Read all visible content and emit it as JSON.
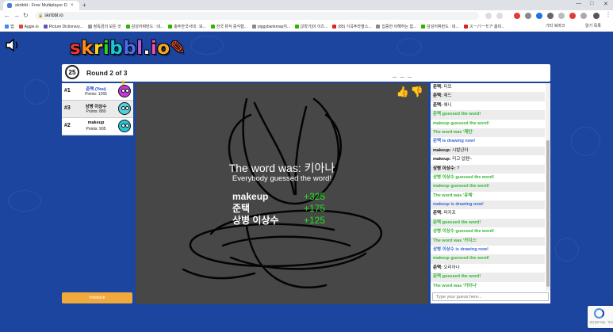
{
  "browser": {
    "tab_title": "skribbl - Free Multiplayer D",
    "tab_close": "×",
    "new_tab": "+",
    "url": "skribbl.io",
    "bookmarks": [
      {
        "label": "앱",
        "color": "#4285f4"
      },
      {
        "label": "Aggie.io",
        "color": "#e0433a"
      },
      {
        "label": "Picture Dictionary...",
        "color": "#6b4fbb"
      },
      {
        "label": "정독곰의 모든 것",
        "color": "#999999"
      },
      {
        "label": "감성어휘만드 : 네...",
        "color": "#2db400"
      },
      {
        "label": "충주한국사대 : 보...",
        "color": "#2db400"
      },
      {
        "label": "전국 뮤식 중식협...",
        "color": "#2db400"
      },
      {
        "label": "piggybankmap지...",
        "color": "#888888"
      },
      {
        "label": "[2학기]이 이즈...",
        "color": "#2db400"
      },
      {
        "label": "(85) 가곡주라열스...",
        "color": "#e02020"
      },
      {
        "label": "집중한 이해하는 힘...",
        "color": "#888888"
      },
      {
        "label": "감성어휘만드 : 네...",
        "color": "#2db400"
      },
      {
        "label": "スーパーモア 홈미...",
        "color": "#e02020"
      }
    ],
    "bookmarks_right": [
      "기타 북마크",
      "읽기 목록"
    ]
  },
  "game": {
    "logo_letters": [
      {
        "ch": "s",
        "color": "#e53935"
      },
      {
        "ch": "k",
        "color": "#ff8c1a"
      },
      {
        "ch": "r",
        "color": "#ffd21f"
      },
      {
        "ch": "i",
        "color": "#2ed12e"
      },
      {
        "ch": "b",
        "color": "#19c6d6"
      },
      {
        "ch": "b",
        "color": "#4a6cf0"
      },
      {
        "ch": "l",
        "color": "#b05be6"
      },
      {
        "ch": ".",
        "color": "#f2f2f2"
      },
      {
        "ch": "i",
        "color": "#ec4fb5"
      },
      {
        "ch": "o",
        "color": "#f5a623"
      },
      {
        "ch": "✎",
        "color": "#ff5722"
      }
    ],
    "timer": "25",
    "round": "Round 2 of 3",
    "hint": "_ _ _",
    "votekick": "Votekick"
  },
  "players": [
    {
      "rank": "#1",
      "name": "준택 (You)",
      "points": "Points: 1265",
      "you": true,
      "avatar_color": "#c23ad6",
      "crown": true
    },
    {
      "rank": "#3",
      "name": "상병 이상수",
      "points": "Points: 880",
      "you": false,
      "avatar_color": "#4fd3e0",
      "crown": false
    },
    {
      "rank": "#2",
      "name": "makeup",
      "points": "Points: 905",
      "you": false,
      "avatar_color": "#22c7d8",
      "crown": false
    }
  ],
  "overlay": {
    "title": "The word was: 키아나",
    "subtitle": "Everybody guessed the word!",
    "scores": [
      {
        "name": "makeup",
        "delta": "+325"
      },
      {
        "name": "준택",
        "delta": "+175"
      },
      {
        "name": "상병 이상수",
        "delta": "+125"
      }
    ]
  },
  "chat": {
    "placeholder": "Type your guess here...",
    "messages": [
      {
        "type": "msg",
        "name": "준택:",
        "text": "티모"
      },
      {
        "type": "msg",
        "name": "준택:",
        "text": "제드"
      },
      {
        "type": "msg",
        "name": "준택:",
        "text": "애니"
      },
      {
        "type": "guess",
        "name": "",
        "text": "준택 guessed the word!"
      },
      {
        "type": "guess",
        "name": "",
        "text": "makeup guessed the word!"
      },
      {
        "type": "word",
        "name": "",
        "text": "The word was '케인'"
      },
      {
        "type": "draw",
        "name": "",
        "text": "준택 is drawing now!"
      },
      {
        "type": "msg",
        "name": "makeup:",
        "text": "시발년아"
      },
      {
        "type": "msg",
        "name": "makeup:",
        "text": "리고 압펜~"
      },
      {
        "type": "msg",
        "name": "상병 이상수:",
        "text": "?"
      },
      {
        "type": "guess",
        "name": "",
        "text": "상병 이상수 guessed the word!"
      },
      {
        "type": "guess",
        "name": "",
        "text": "makeup guessed the word!"
      },
      {
        "type": "word",
        "name": "",
        "text": "The word was '유체'"
      },
      {
        "type": "draw",
        "name": "",
        "text": "makeup is drawing now!"
      },
      {
        "type": "msg",
        "name": "준택:",
        "text": "마지프"
      },
      {
        "type": "guess",
        "name": "",
        "text": "준택 guessed the word!"
      },
      {
        "type": "guess",
        "name": "",
        "text": "상병 이상수 guessed the word!"
      },
      {
        "type": "word",
        "name": "",
        "text": "The word was '카지스'"
      },
      {
        "type": "draw",
        "name": "",
        "text": "상병 이상수 is drawing now!"
      },
      {
        "type": "guess",
        "name": "",
        "text": "makeup guessed the word!"
      },
      {
        "type": "msg",
        "name": "준택:",
        "text": "오리아나"
      },
      {
        "type": "guess",
        "name": "",
        "text": "준택 guessed the word!"
      },
      {
        "type": "word",
        "name": "",
        "text": "The word was '키아나'"
      }
    ]
  }
}
